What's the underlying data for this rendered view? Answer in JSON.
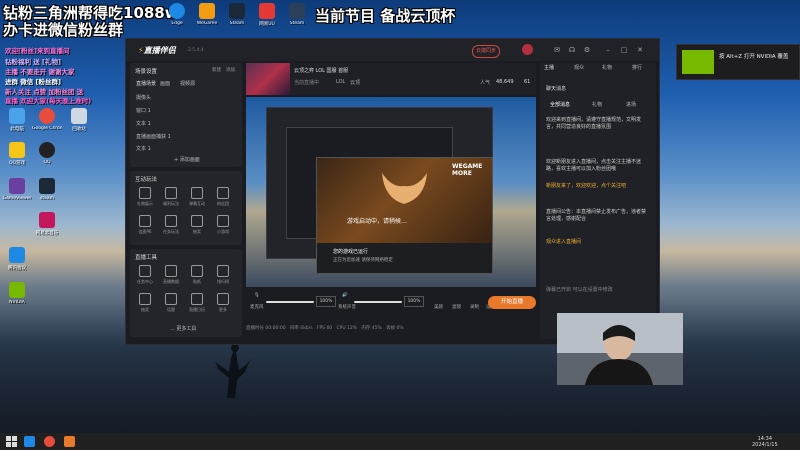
{
  "overlay": {
    "line1": "钻粉三角洲帮得吃1088w",
    "line2": "办卡进微信粉丝群",
    "program": "当前节目 备战云顶杯",
    "chat": [
      "欢迎[粉丝]来到直播间",
      "钻粉福利 送 [礼物]",
      "主播 不要走开 谢谢大家",
      "进群 微信 [粉丝群]",
      "新人关注 点赞 加粉丝团 送",
      "直播 欢迎大家(每天晚上准时)"
    ]
  },
  "desktop_icons": [
    {
      "label": "此电脑",
      "color": "#4aa3e8"
    },
    {
      "label": "Google Chrome",
      "color": "#e94b3c"
    },
    {
      "label": "回收站",
      "color": "#cfd8e3"
    },
    {
      "label": "QQ游戏",
      "color": "#f5c518"
    },
    {
      "label": "QQ",
      "color": "#222222"
    },
    {
      "label": "GameViewer",
      "color": "#6b3fa0"
    },
    {
      "label": "steam",
      "color": "#1b2838"
    },
    {
      "label": "网易云音乐",
      "color": "#c2185b"
    },
    {
      "label": "腾讯会议",
      "color": "#1e88e5"
    },
    {
      "label": "NVIDIA",
      "color": "#76b900"
    }
  ],
  "taskbar_top_icons": [
    {
      "label": "Edge",
      "color": "#1e88e5"
    },
    {
      "label": "WeGame",
      "color": "#f39c12"
    },
    {
      "label": "Steam",
      "color": "#1b2838"
    },
    {
      "label": "网易UU",
      "color": "#e53935"
    },
    {
      "label": "Steam",
      "color": "#2a3f5a"
    },
    {
      "label": "Steam++",
      "color": "#333333"
    }
  ],
  "app": {
    "title": "直播伴侣",
    "version": "2.5.4.4",
    "upgrade_btn": "云端同步",
    "titlebar_icons": [
      "avatar-icon",
      "mail-icon",
      "headset-icon",
      "settings-icon",
      "minimize-icon",
      "maximize-icon",
      "close-icon"
    ],
    "scene_header": "场景设置",
    "scene_header_right": [
      "新建",
      "添加"
    ],
    "scene_tabs": [
      "直播场景",
      "画面",
      "视频源"
    ],
    "scene_rows": [
      "摄像头",
      "窗口 1",
      "文本 1",
      "直播画面捕获 1",
      "文本 1"
    ],
    "add_scene": "+ 添加画面",
    "interact_title": "互动玩法",
    "interact_tools": [
      "礼物展示",
      "福利玩法",
      "弹幕互动",
      "粉丝团",
      "连麦PK",
      "任务玩法",
      "抽奖",
      "小游戏"
    ],
    "live_tools_title": "直播工具",
    "live_tools": [
      "任务中心",
      "直播数据",
      "贴纸",
      "排行榜",
      "抽奖",
      "话题",
      "直播日历",
      "更多"
    ],
    "more_tools": "... 更多工具",
    "game_title": "云顶之弈 LOL 国服 首服",
    "game_sub": "当前直播中",
    "game_tags": [
      "LOL",
      "云顶"
    ],
    "stat_label": "人气",
    "stat_value": "48,649",
    "stat2": "61",
    "wegame": {
      "logo": "WEGAME\nMORE",
      "main_text": "游戏启动中，请稍候…",
      "bar1": "您的游戏已运行",
      "bar2": "正在为您加速 请保持网络稳定"
    },
    "controls": {
      "mic_label": "麦克风",
      "mic_pct": "100%",
      "sys_label": "系统声音",
      "sys_pct": "100%",
      "icons": [
        "美颜",
        "滤镜",
        "录制",
        "设置"
      ]
    },
    "live_btn": "开始直播",
    "status": [
      "直播时长 00:00:00",
      "码率 0kb/s",
      "FPS 60",
      "CPU 12%",
      "内存 45%",
      "丢帧 0%"
    ],
    "right": {
      "header": "聊天消息",
      "tabs": [
        "全部消息",
        "礼物",
        "进场"
      ],
      "msgs": [
        "欢迎来到直播间，请遵守直播规范，文明发言，共同营造良好的直播氛围",
        "欢迎新朋友进入直播间，点击关注主播不迷路，喜欢主播可以加入粉丝团哦",
        "新朋友来了，欢迎欢迎，点个关注吧",
        "直播间公告：本直播间禁止发布广告，违者禁言处理，感谢配合",
        "观众进入直播间"
      ],
      "footer": "弹幕已开启 可以在设置中修改"
    },
    "chat_tabs": [
      "主播",
      "观众",
      "礼物",
      "排行"
    ]
  },
  "nvidia": {
    "text": "按 Alt+Z 打开 NVIDIA 覆盖"
  },
  "taskbar": {
    "time": "14:34",
    "date": "2024/1/15"
  }
}
